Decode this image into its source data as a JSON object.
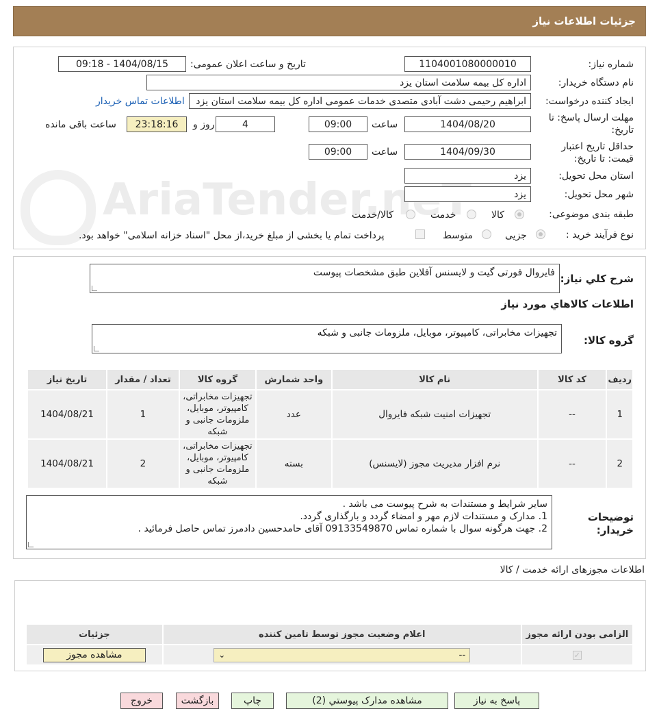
{
  "header": {
    "title": "جزئیات اطلاعات نیاز"
  },
  "form": {
    "need_number_label": "شماره نیاز:",
    "need_number": "1104001080000010",
    "announce_label": "تاریخ و ساعت اعلان عمومی:",
    "announce_value": "1404/08/15 - 09:18",
    "buyer_org_label": "نام دستگاه خریدار:",
    "buyer_org": "اداره کل بیمه سلامت استان یزد",
    "requester_label": "ایجاد کننده درخواست:",
    "requester": "ابراهیم رحیمی دشت آبادی متصدی خدمات عمومی اداره کل بیمه سلامت استان یزد",
    "buyer_contact_link": "اطلاعات تماس خریدار",
    "deadline_label_1": "مهلت ارسال پاسخ: تا",
    "deadline_label_2": "تاریخ:",
    "deadline_date": "1404/08/20",
    "time_label": "ساعت",
    "deadline_time": "09:00",
    "days_value": "4",
    "days_label": "روز و",
    "remaining_time": "23:18:16",
    "remaining_label": "ساعت باقی مانده",
    "validity_label_1": "حداقل تاریخ اعتبار",
    "validity_label_2": "قیمت: تا تاریخ:",
    "validity_date": "1404/09/30",
    "validity_time": "09:00",
    "province_label": "استان محل تحویل:",
    "province": "یزد",
    "city_label": "شهر محل تحویل:",
    "city": "یزد",
    "category_label": "طبقه بندی موضوعی:",
    "category_options": [
      "کالا",
      "خدمت",
      "کالا/خدمت"
    ],
    "purchase_type_label": "نوع فرآیند خرید :",
    "purchase_options": [
      "جزیی",
      "متوسط"
    ],
    "payment_note": "پرداخت تمام یا بخشی از مبلغ خرید،از محل \"اسناد خزانه اسلامی\" خواهد بود."
  },
  "description": {
    "label": "شرح کلي نياز:",
    "value": "فایروال فورتی گیت و لایسنس آفلاین طبق مشخصات پیوست"
  },
  "goods_section": {
    "title": "اطلاعات کالاهاي مورد نياز",
    "group_label": "گروه کالا:",
    "group_value": "تجهیزات مخابراتی، کامپیوتر، موبایل، ملزومات جانبی و شبکه"
  },
  "goods_table": {
    "headers": [
      "ردیف",
      "کد کالا",
      "نام کالا",
      "واحد شمارش",
      "گروه کالا",
      "تعداد / مقدار",
      "تاریخ نیاز"
    ],
    "rows": [
      [
        "1",
        "--",
        "تجهیزات امنیت شبکه فایروال",
        "عدد",
        "تجهیزات مخابراتی، کامپیوتر، موبایل، ملزومات جانبی و شبکه",
        "1",
        "1404/08/21"
      ],
      [
        "2",
        "--",
        "نرم افزار مدیریت مجوز (لایسنس)",
        "بسته",
        "تجهیزات مخابراتی، کامپیوتر، موبایل، ملزومات جانبی و شبکه",
        "2",
        "1404/08/21"
      ]
    ]
  },
  "buyer_notes": {
    "label_1": "توضیحات",
    "label_2": "خریدار:",
    "lines": [
      "سایر شرایط و مستندات به شرح پیوست می باشد .",
      "1. مدارک و مستندات لازم مهر و امضاء گردد و بارگذاری گردد.",
      "2. جهت هرگونه سوال با شماره تماس 09133549870 آقای حامدحسین دادمرز تماس حاصل فرمائید ."
    ]
  },
  "permits": {
    "title": "اطلاعات مجوزهای ارائه خدمت / کالا",
    "headers": [
      "الزامی بودن ارائه مجوز",
      "اعلام وضعیت مجوز توسط تامین کننده",
      "جزئیات"
    ],
    "select_value": "--",
    "view_button": "مشاهده مجوز"
  },
  "buttons": {
    "reply": "پاسخ به نیاز",
    "attachments": "مشاهده مدارک پیوستي (2)",
    "print": "چاپ",
    "back": "بازگشت",
    "exit": "خروج"
  },
  "watermark": "AriaTender.neT",
  "colors": {
    "header": "#a37f55",
    "link": "#1a5fb4",
    "yellow": "#f6efc0",
    "green": "#e5f5dc",
    "pink": "#f9d9dc"
  }
}
